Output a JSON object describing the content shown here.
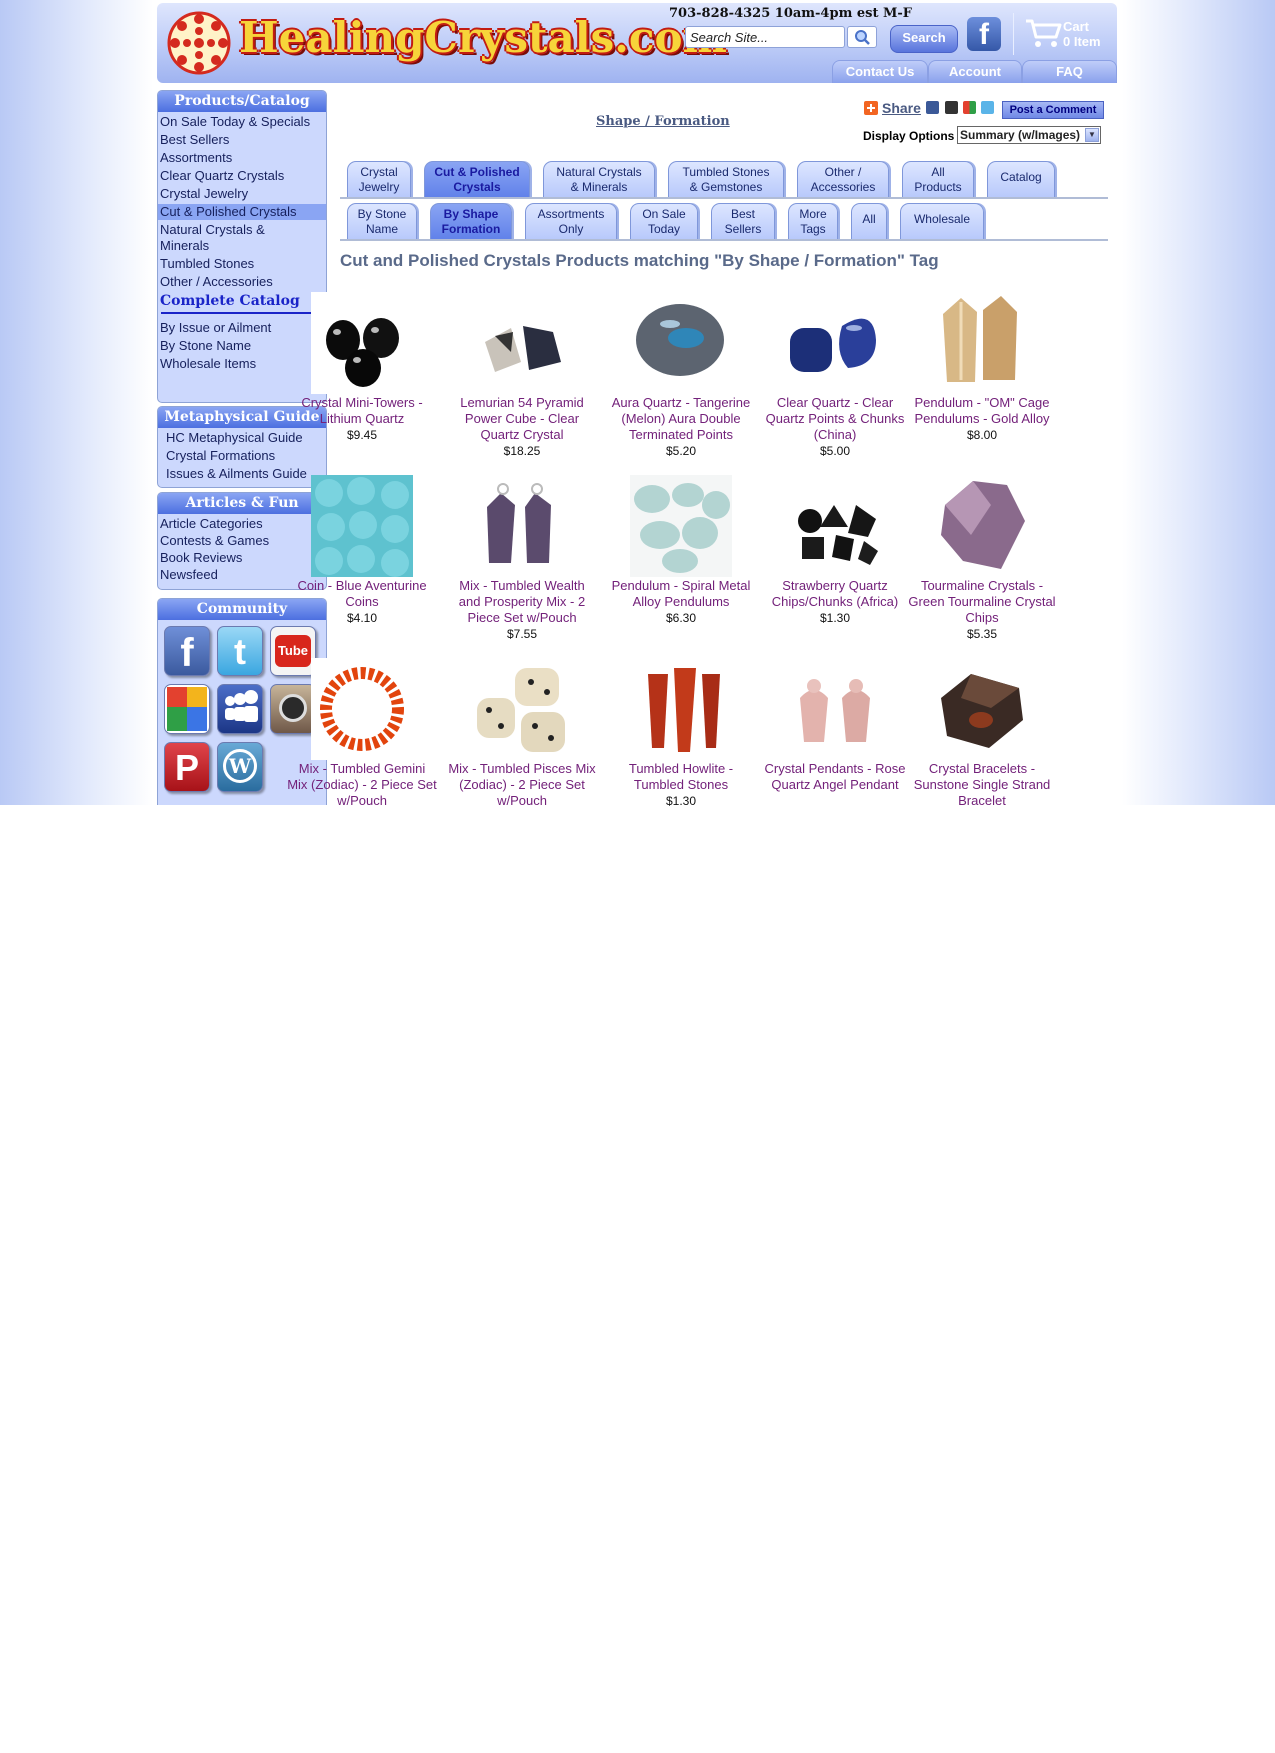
{
  "header": {
    "logo_text": "HealingCrystals.com",
    "phone": "703-828-4325 10am-4pm est M-F",
    "search_placeholder": "Search Site...",
    "search_button": "Search",
    "facebook_glyph": "f",
    "cart_label": "Cart",
    "cart_items": "0 Item",
    "top_tabs": [
      "Contact Us",
      "Account",
      "FAQ"
    ]
  },
  "sidebar": {
    "products_title": "Products/Catalog",
    "products_items": [
      "On Sale Today & Specials",
      "Best Sellers",
      "Assortments",
      "Clear Quartz Crystals",
      "Crystal Jewelry",
      "Cut & Polished Crystals",
      "Natural Crystals & Minerals",
      "Tumbled Stones",
      "Other / Accessories"
    ],
    "complete_catalog": "Complete Catalog",
    "catalog_links": [
      "By Issue or Ailment",
      "By Stone Name",
      "Wholesale Items"
    ],
    "metaphysical_title": "Metaphysical Guide",
    "metaphysical_items": [
      "HC Metaphysical Guide",
      "Crystal Formations",
      "Issues & Ailments Guide"
    ],
    "articles_title": "Articles & Fun",
    "articles_items": [
      "Article Categories",
      "Contests & Games",
      "Book Reviews",
      "Newsfeed"
    ],
    "community_title": "Community",
    "social_icons": [
      "facebook-icon",
      "twitter-icon",
      "youtube-icon",
      "google-icon",
      "myspace-icon",
      "instagram-icon",
      "pinterest-icon",
      "wordpress-icon"
    ]
  },
  "main": {
    "breadcrumb": "Shape / Formation",
    "share_label": "Share",
    "post_comment": "Post a Comment",
    "display_options_label": "Display Options",
    "display_options_value": "Summary (w/Images)",
    "category_tabs": [
      "Crystal Jewelry",
      "Cut & Polished Crystals",
      "Natural Crystals & Minerals",
      "Tumbled Stones & Gemstones",
      "Other / Accessories",
      "All Products",
      "Catalog"
    ],
    "active_category": "Cut & Polished Crystals",
    "filter_tabs": [
      "By Stone Name",
      "By Shape Formation",
      "Assortments Only",
      "On Sale Today",
      "Best Sellers",
      "More Tags",
      "All",
      "Wholesale"
    ],
    "active_filter": "By Shape Formation",
    "heading": "Cut and Polished Crystals Products matching \"By Shape / Formation\" Tag",
    "products": [
      {
        "name": "Crystal Mini-Towers - Lithium Quartz",
        "price": "$9.45"
      },
      {
        "name": "Lemurian 54 Pyramid Power Cube - Clear Quartz Crystal",
        "price": "$18.25"
      },
      {
        "name": "Aura Quartz - Tangerine (Melon) Aura Double Terminated Points",
        "price": "$5.20"
      },
      {
        "name": "Clear Quartz - Clear Quartz Points & Chunks (China)",
        "price": "$5.00"
      },
      {
        "name": "Pendulum - \"OM\" Cage Pendulums - Gold Alloy",
        "price": "$8.00"
      },
      {
        "name": "Coin - Blue Aventurine Coins",
        "price": "$4.10"
      },
      {
        "name": "Mix - Tumbled Wealth and Prosperity Mix - 2 Piece Set w/Pouch",
        "price": "$7.55"
      },
      {
        "name": "Pendulum - Spiral Metal Alloy Pendulums",
        "price": "$6.30"
      },
      {
        "name": "Strawberry Quartz Chips/Chunks (Africa)",
        "price": "$1.30"
      },
      {
        "name": "Tourmaline Crystals - Green Tourmaline Crystal Chips",
        "price": "$5.35"
      },
      {
        "name": "Mix - Tumbled Gemini Mix (Zodiac) - 2 Piece Set w/Pouch",
        "price": ""
      },
      {
        "name": "Mix - Tumbled Pisces Mix (Zodiac) - 2 Piece Set w/Pouch",
        "price": ""
      },
      {
        "name": "Tumbled Howlite - Tumbled Stones",
        "price": "$1.30"
      },
      {
        "name": "Crystal Pendants - Rose Quartz Angel Pendant",
        "price": ""
      },
      {
        "name": "Crystal Bracelets - Sunstone Single Strand Bracelet",
        "price": ""
      }
    ]
  }
}
